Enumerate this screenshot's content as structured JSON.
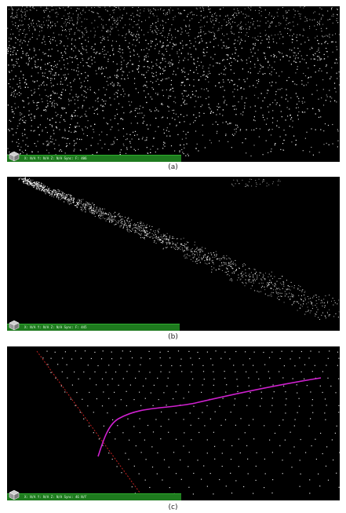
{
  "panels": [
    {
      "id": "a",
      "caption": "(a)",
      "status": "X: N/A Y: N/A Z: N/A Sync: F: 406"
    },
    {
      "id": "b",
      "caption": "(b)",
      "status": "X: N/A Y: N/A Z: N/A Sync: F: 445"
    },
    {
      "id": "c",
      "caption": "(c)",
      "status": "X: N/A Y: N/A Z: N/A Sync: 46 N/F"
    }
  ],
  "colors": {
    "background": "#000000",
    "points": "#ffffff",
    "status_bar": "#1e7a1e",
    "trajectory": "#d020d0",
    "axis_line": "#c02020"
  },
  "icons": [
    "cube-icon"
  ]
}
